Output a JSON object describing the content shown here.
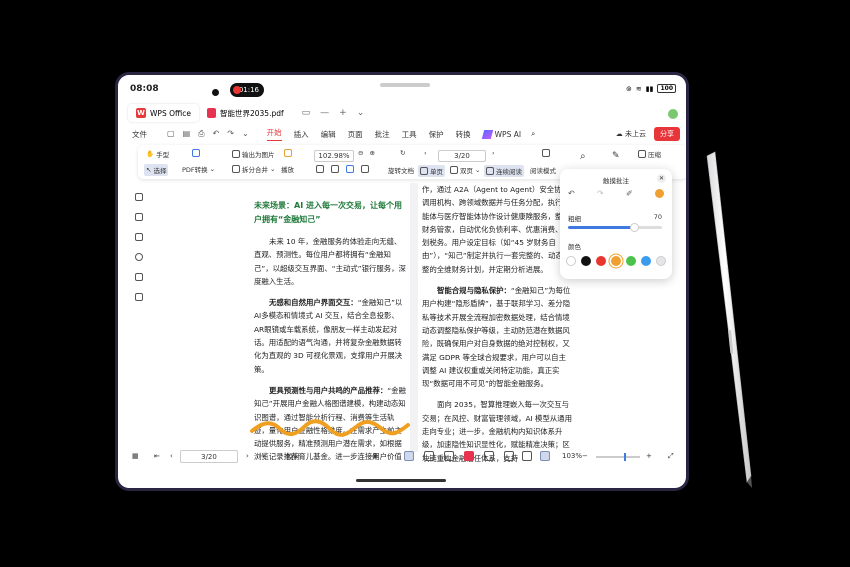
{
  "status": {
    "time": "08:08",
    "rec_time": "01:16",
    "battery": "100"
  },
  "tabs": [
    {
      "label": "WPS Office"
    },
    {
      "label": "智能世界2035.pdf"
    }
  ],
  "menu": {
    "file": "文件",
    "items": [
      "开始",
      "插入",
      "编辑",
      "页面",
      "批注",
      "工具",
      "保护",
      "转换"
    ],
    "wps_ai": "WPS AI",
    "cloud": "未上云",
    "share": "分享"
  },
  "toolbar": {
    "hand": "手型",
    "select": "选择",
    "pdf_convert": "PDF转换",
    "export_image": "输出为图片",
    "split_merge": "拆分合并",
    "play": "播放",
    "zoom": "102.98%",
    "rotate": "旋转文档",
    "page": "3/20",
    "single": "单页",
    "double": "双页",
    "continuous": "连续阅读",
    "reading": "阅读模式",
    "compress": "压缩"
  },
  "pen_panel": {
    "title": "触摸批注",
    "thickness_label": "粗细",
    "thickness_value": "70",
    "thickness_fraction": 0.7,
    "color_label": "颜色",
    "colors": [
      "#ffffff",
      "#111111",
      "#e8352e",
      "#f0a030",
      "#4cc24c",
      "#3a9cf0",
      "#e6e6ea"
    ]
  },
  "document": {
    "left": {
      "heading": "未来场景：AI 进入每一次交易，让每个用户拥有“金融知己”",
      "p1": "未来 10 年，金融服务的体验走向无缝、直观、预测性。每位用户都将拥有“金融知己”，以超级交互界面、“主动式”银行服务，深度融入生活。",
      "p2_bold": "无感和自然用户界面交互：",
      "p2": "“金融知己”以AI多模态和情境式 AI 交互，结合全息投影、AR眼镜或车载系统，像朋友一样主动发起对话。用适配的语气沟通，并将复杂金融数据转化为直观的 3D 可视化景观，支撑用户开展决策。",
      "p3_bold": "更具预测性与用户共鸣的产品推荐：",
      "p3": "“金融知己”开展用户金融人格图谱建模，构建动态知识图谱，通过智能分析行程、消费等生活轨迹，量化用户金融性格维度。在需求产生前主动提供服务，精准预测用户潜在需求，如根据浏览记录推荐育儿基金。进一步连接用户价值"
    },
    "right": {
      "p1": "作，通过 A2A（Agent to Agent）安全协议调用机构、跨领域数据并与任务分配，执行每能体与医疗智能体协作设计健康険服务，整体财务管家，自动优化负债利率、优惠消费、规划税务。用户设定目标（如“45 岁财务自由”），“知己”制定并执行一套完整的、动态调整的全维财务计划，并定期分析进展。",
      "p2_bold": "智能合规与隐私保护：",
      "p2": "“金融知己”为每位用户构建“隐形盾牌”，基于联邦学习、差分隐私等技术开展全流程加密数据处理，结合情境动态调整隐私保护等级，主动防范潜在数据风险，既确保用户对自身数据的绝对控制权，又满足 GDPR 等全球合规要求，用户可以自主调整 AI 建议权重或关闭特定功能，真正实现“数据可用不可见”的智能金融服务。",
      "p3": "面向 2035，智算推理嵌入每一次交互与交易；在风控、财富管理领域，AI 模型从通用走向专业；进一步，金融机构内知识体系升级，加速隐性知识显性化，赋能精准决策；区块链重构金融信任体系，支持"
    }
  },
  "bottom": {
    "page": "3/20",
    "proofread": "校对",
    "zoom": "103%"
  }
}
